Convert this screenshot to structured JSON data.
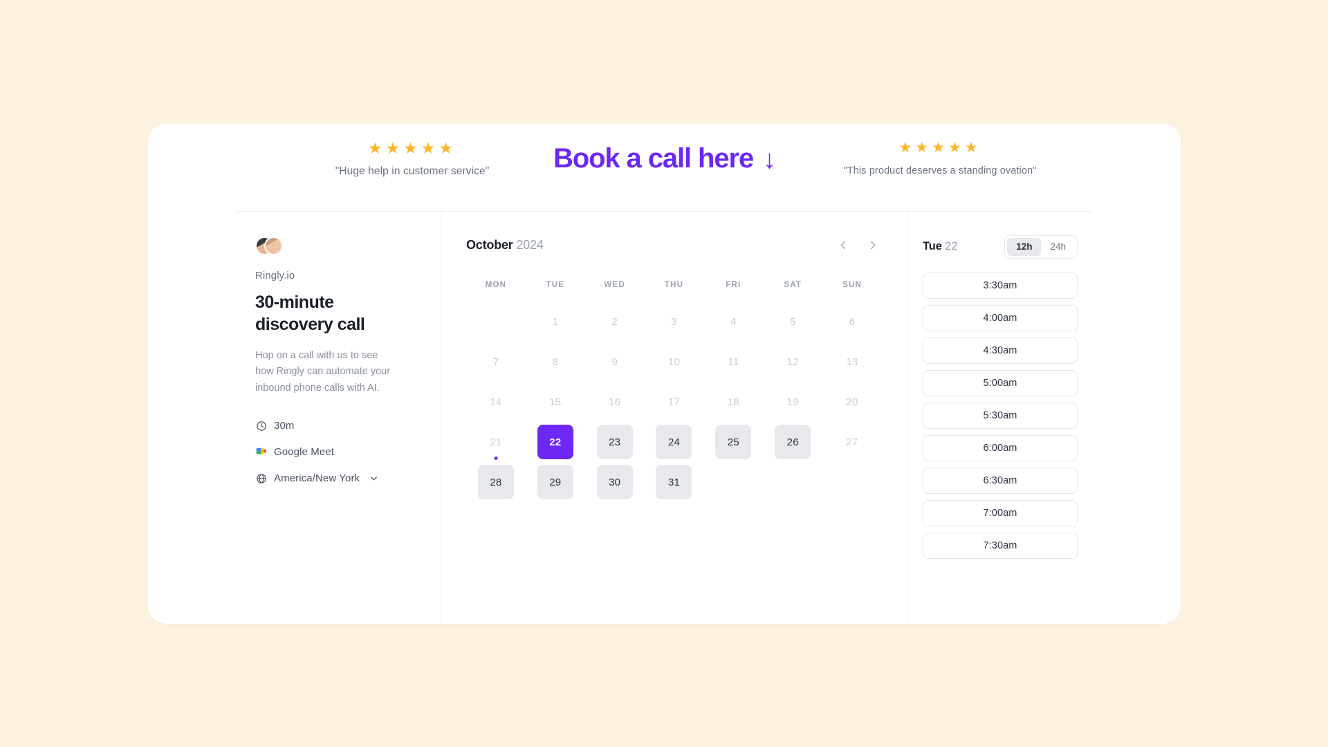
{
  "testimonial_left": {
    "stars": "★★★★★",
    "quote": "\"Huge help in customer service\""
  },
  "testimonial_right": {
    "stars": "★★★★★",
    "quote": "\"This product deserves a standing ovation\""
  },
  "headline": {
    "text": "Book a call here",
    "arrow": "↓"
  },
  "event": {
    "org_name": "Ringly.io",
    "title": "30-minute discovery call",
    "description": "Hop on a call with us to see how Ringly can automate your inbound phone calls with AI.",
    "duration": "30m",
    "location": "Google Meet",
    "timezone": "America/New York",
    "timezone_chevron": "chevron-down"
  },
  "calendar": {
    "month": "October",
    "year": "2024",
    "prev_label": "‹",
    "next_label": "›",
    "weekdays": [
      "MON",
      "TUE",
      "WED",
      "THU",
      "FRI",
      "SAT",
      "SUN"
    ],
    "leading_blanks": 1,
    "days": [
      {
        "n": "1",
        "state": "disabled"
      },
      {
        "n": "2",
        "state": "disabled"
      },
      {
        "n": "3",
        "state": "disabled"
      },
      {
        "n": "4",
        "state": "disabled"
      },
      {
        "n": "5",
        "state": "disabled"
      },
      {
        "n": "6",
        "state": "disabled"
      },
      {
        "n": "7",
        "state": "disabled"
      },
      {
        "n": "8",
        "state": "disabled"
      },
      {
        "n": "9",
        "state": "disabled"
      },
      {
        "n": "10",
        "state": "disabled"
      },
      {
        "n": "11",
        "state": "disabled"
      },
      {
        "n": "12",
        "state": "disabled"
      },
      {
        "n": "13",
        "state": "disabled"
      },
      {
        "n": "14",
        "state": "disabled"
      },
      {
        "n": "15",
        "state": "disabled"
      },
      {
        "n": "16",
        "state": "disabled"
      },
      {
        "n": "17",
        "state": "disabled"
      },
      {
        "n": "18",
        "state": "disabled"
      },
      {
        "n": "19",
        "state": "disabled"
      },
      {
        "n": "20",
        "state": "disabled"
      },
      {
        "n": "21",
        "state": "disabled",
        "today": true
      },
      {
        "n": "22",
        "state": "selected"
      },
      {
        "n": "23",
        "state": "available"
      },
      {
        "n": "24",
        "state": "available"
      },
      {
        "n": "25",
        "state": "available"
      },
      {
        "n": "26",
        "state": "available"
      },
      {
        "n": "27",
        "state": "disabled"
      },
      {
        "n": "28",
        "state": "available"
      },
      {
        "n": "29",
        "state": "available"
      },
      {
        "n": "30",
        "state": "available"
      },
      {
        "n": "31",
        "state": "available"
      }
    ]
  },
  "slots": {
    "weekday": "Tue",
    "daynum": "22",
    "hour_format_options": [
      "12h",
      "24h"
    ],
    "hour_format_selected": "12h",
    "times": [
      "3:30am",
      "4:00am",
      "4:30am",
      "5:00am",
      "5:30am",
      "6:00am",
      "6:30am",
      "7:00am",
      "7:30am"
    ]
  },
  "colors": {
    "background": "#fdf2e0",
    "accent": "#6d28f5",
    "star": "#fdb528",
    "available_day": "#e8e9ec"
  }
}
